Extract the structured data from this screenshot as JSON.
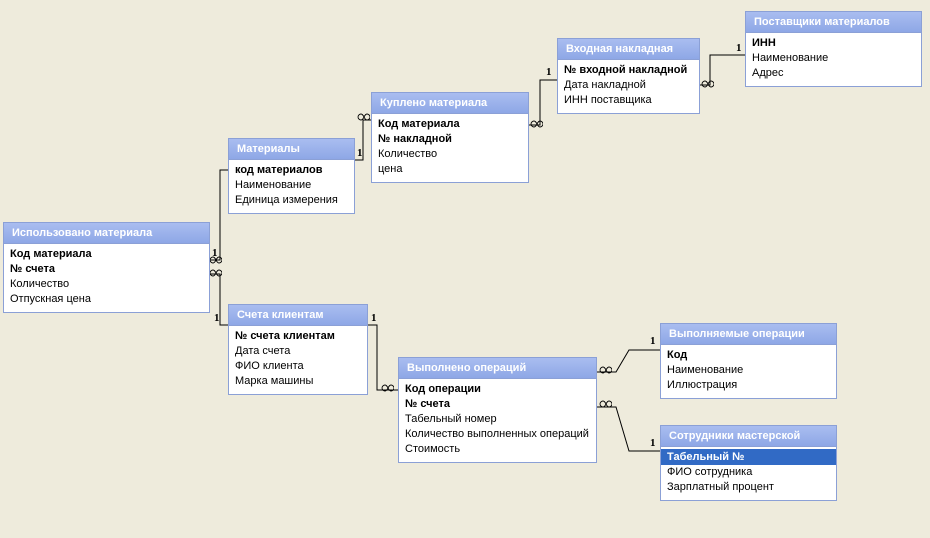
{
  "tables": {
    "used_material": {
      "title": "Использовано материала",
      "fields": [
        "Код материала",
        "№ счета",
        "Количество",
        "Отпускная цена"
      ]
    },
    "materials": {
      "title": "Материалы",
      "fields": [
        "код материалов",
        "Наименование",
        "Единица измерения"
      ]
    },
    "bought_material": {
      "title": "Куплено материала",
      "fields": [
        "Код материала",
        "№ накладной",
        "Количество",
        "цена"
      ]
    },
    "incoming_invoice": {
      "title": "Входная накладная",
      "fields": [
        "№ входной накладной",
        "Дата накладной",
        "ИНН поставщика"
      ]
    },
    "suppliers": {
      "title": "Поставщики материалов",
      "fields": [
        "ИНН",
        "Наименование",
        "Адрес"
      ]
    },
    "client_accounts": {
      "title": "Счета клиентам",
      "fields": [
        "№ счета клиентам",
        "Дата счета",
        "ФИО клиента",
        "Марка машины"
      ]
    },
    "operations_done": {
      "title": "Выполнено операций",
      "fields": [
        "Код операции",
        "№ счета",
        "Табельный номер",
        "Количество выполненных операций",
        "Стоимость"
      ]
    },
    "operations": {
      "title": "Выполняемые операции",
      "fields": [
        "Код",
        "Наименование",
        "Иллюстрация"
      ]
    },
    "employees": {
      "title": "Сотрудники мастерской",
      "fields": [
        "Табельный №",
        "ФИО сотрудника",
        "Зарплатный процент"
      ]
    }
  },
  "labels": {
    "one": "1"
  }
}
